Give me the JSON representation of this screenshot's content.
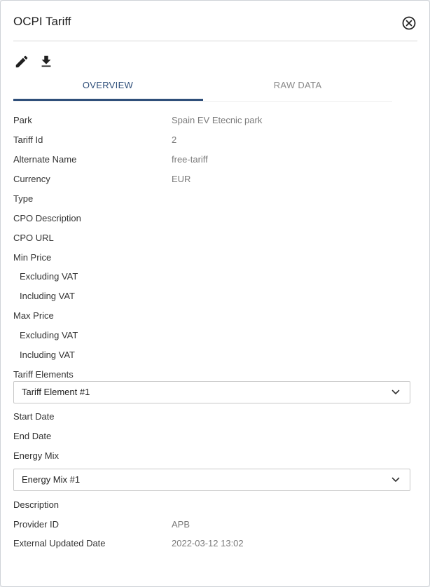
{
  "dialog": {
    "title": "OCPI Tariff"
  },
  "icons": {
    "close": "close-circle-icon",
    "edit": "pencil-icon",
    "download": "download-icon",
    "chevron": "chevron-down-icon"
  },
  "tabs": [
    {
      "label": "OVERVIEW",
      "active": true
    },
    {
      "label": "RAW DATA",
      "active": false
    }
  ],
  "fields": {
    "park": {
      "label": "Park",
      "value": "Spain EV Etecnic park"
    },
    "tariff_id": {
      "label": "Tariff Id",
      "value": "2"
    },
    "alternate_name": {
      "label": "Alternate Name",
      "value": "free-tariff"
    },
    "currency": {
      "label": "Currency",
      "value": "EUR"
    },
    "type": {
      "label": "Type",
      "value": ""
    },
    "cpo_description": {
      "label": "CPO Description",
      "value": ""
    },
    "cpo_url": {
      "label": "CPO URL",
      "value": ""
    },
    "min_price": {
      "label": "Min Price"
    },
    "min_excl_vat": {
      "label": "Excluding VAT",
      "value": ""
    },
    "min_incl_vat": {
      "label": "Including VAT",
      "value": ""
    },
    "max_price": {
      "label": "Max Price"
    },
    "max_excl_vat": {
      "label": "Excluding VAT",
      "value": ""
    },
    "max_incl_vat": {
      "label": "Including VAT",
      "value": ""
    },
    "tariff_elements": {
      "label": "Tariff Elements"
    },
    "start_date": {
      "label": "Start Date",
      "value": ""
    },
    "end_date": {
      "label": "End Date",
      "value": ""
    },
    "energy_mix": {
      "label": "Energy Mix"
    },
    "description": {
      "label": "Description",
      "value": ""
    },
    "provider_id": {
      "label": "Provider ID",
      "value": "APB"
    },
    "external_updated_date": {
      "label": "External Updated Date",
      "value": "2022-03-12 13:02"
    }
  },
  "tariff_element_select": {
    "selected": "Tariff Element #1"
  },
  "energy_mix_select": {
    "selected": "Energy Mix #1"
  },
  "colors": {
    "accent": "#2f4f7a",
    "label_text": "#333333",
    "value_text": "#7a7a7a"
  }
}
